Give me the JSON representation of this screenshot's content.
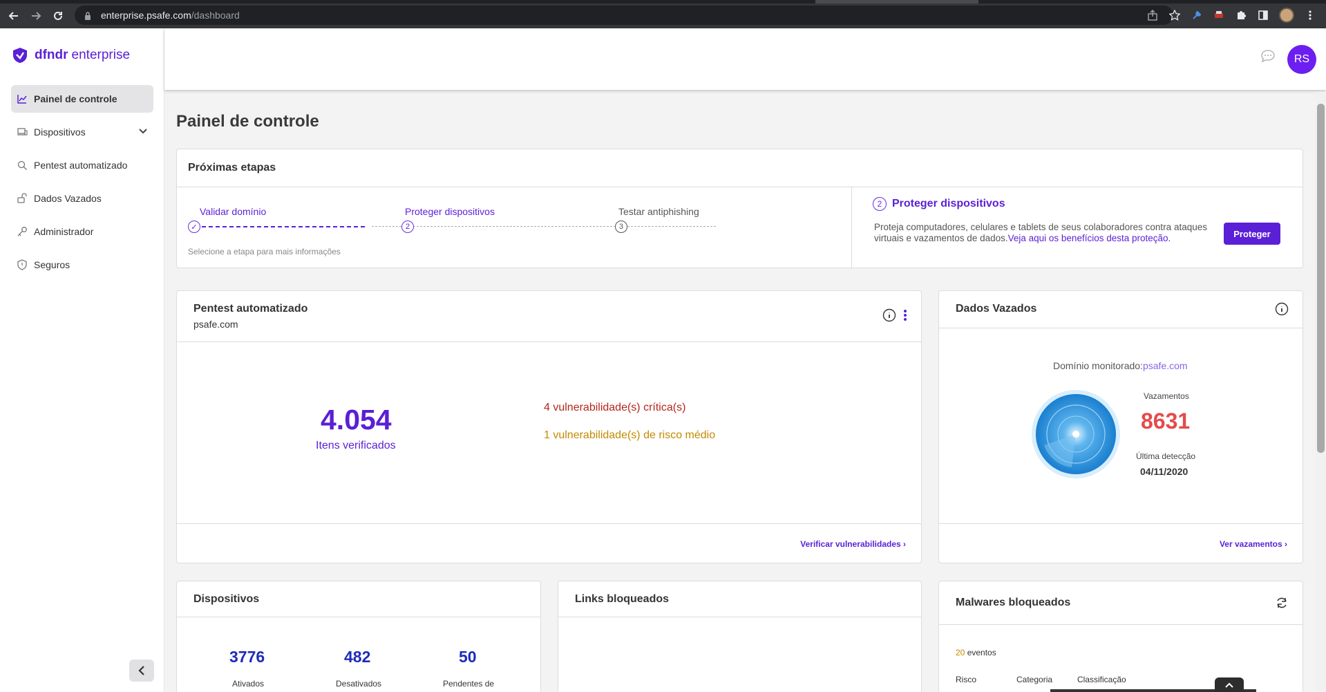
{
  "browser": {
    "url_host": "enterprise.psafe.com",
    "url_path": "/dashboard"
  },
  "brand": {
    "name_bold": "dfndr",
    "name_light": "enterprise",
    "accent_color": "#5a1fd6"
  },
  "sidebar": {
    "items": [
      {
        "label": "Painel de controle",
        "icon": "chart-icon",
        "active": true
      },
      {
        "label": "Dispositivos",
        "icon": "devices-icon",
        "active": false
      },
      {
        "label": "Pentest automatizado",
        "icon": "search-icon",
        "active": false
      },
      {
        "label": "Dados Vazados",
        "icon": "unlock-icon",
        "active": false
      },
      {
        "label": "Administrador",
        "icon": "key-icon",
        "active": false
      },
      {
        "label": "Seguros",
        "icon": "shield-icon",
        "active": false
      }
    ]
  },
  "header": {
    "avatar_initials": "RS"
  },
  "page": {
    "title": "Painel de controle"
  },
  "next_steps": {
    "title": "Próximas etapas",
    "steps": [
      {
        "label": "Validar domínio",
        "marker": "✓",
        "state": "done"
      },
      {
        "label": "Proteger dispositivos",
        "marker": "2",
        "state": "current"
      },
      {
        "label": "Testar antiphishing",
        "marker": "3",
        "state": "pending"
      }
    ],
    "hint": "Selecione a etapa para mais informações",
    "detail": {
      "number": "2",
      "title": "Proteger dispositivos",
      "text": "Proteja computadores, celulares e tablets de seus colaboradores contra ataques virtuais e vazamentos de dados.",
      "link": "Veja aqui os benefícios desta proteção.",
      "button": "Proteger"
    }
  },
  "pentest": {
    "title": "Pentest automatizado",
    "domain": "psafe.com",
    "items_checked": "4.054",
    "items_label": "Itens verificados",
    "critical": "4 vulnerabilidade(s) crítica(s)",
    "medium": "1 vulnerabilidade(s) de risco médio",
    "link": "Verificar vulnerabilidades ›"
  },
  "leaks": {
    "title": "Dados Vazados",
    "domain_label": "Domínio monitorado:",
    "domain": "psafe.com",
    "count_label": "Vazamentos",
    "count": "8631",
    "last_label": "Última detecção",
    "last_date": "04/11/2020",
    "link": "Ver vazamentos ›"
  },
  "devices": {
    "title": "Dispositivos",
    "stats": [
      {
        "value": "3776",
        "label": "Ativados"
      },
      {
        "value": "482",
        "label": "Desativados"
      },
      {
        "value": "50",
        "label": "Pendentes de"
      }
    ]
  },
  "links_blocked": {
    "title": "Links bloqueados"
  },
  "malware": {
    "title": "Malwares bloqueados",
    "events_count": "20",
    "events_label": "eventos",
    "columns": [
      "Risco",
      "Categoria",
      "Classificação"
    ]
  }
}
